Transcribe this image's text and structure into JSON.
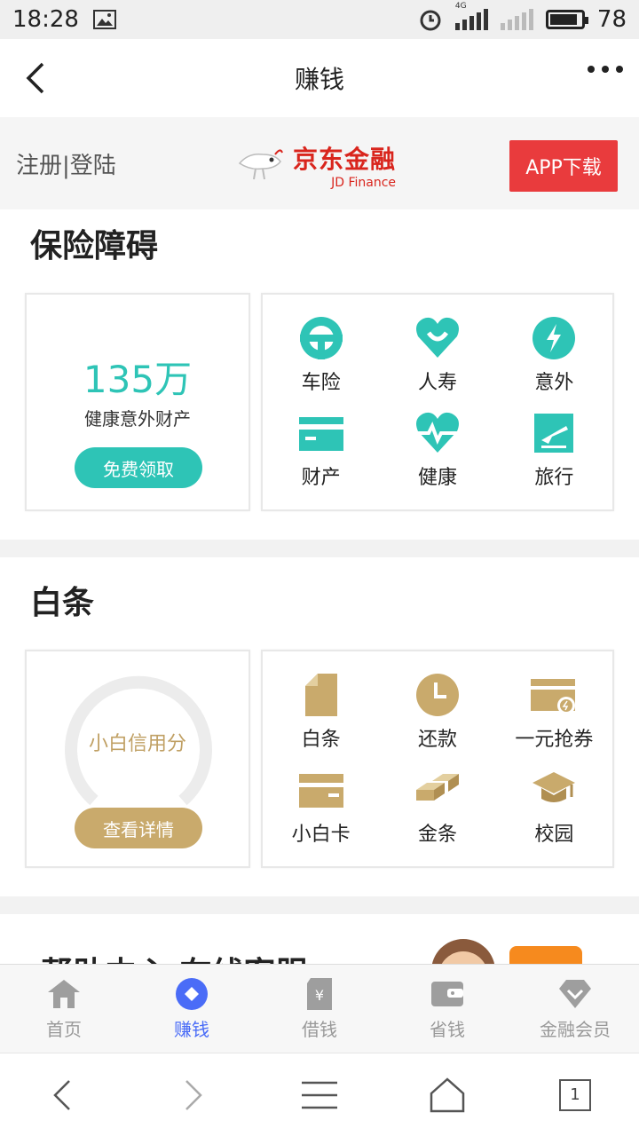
{
  "status_bar": {
    "time": "18:28",
    "network": "4G",
    "battery_level": "78"
  },
  "header": {
    "title": "赚钱"
  },
  "banner": {
    "login_label": "注册|登陆",
    "brand_cn": "京东金融",
    "brand_en": "JD Finance",
    "download_label": "APP下载"
  },
  "insurance": {
    "title": "保险障碍",
    "amount": "135万",
    "amount_desc": "健康意外财产",
    "claim_label": "免费领取",
    "items": [
      {
        "label": "车险",
        "icon": "car-insurance-icon"
      },
      {
        "label": "人寿",
        "icon": "life-heart-icon"
      },
      {
        "label": "意外",
        "icon": "lightning-icon"
      },
      {
        "label": "财产",
        "icon": "card-icon"
      },
      {
        "label": "健康",
        "icon": "health-heart-icon"
      },
      {
        "label": "旅行",
        "icon": "plane-icon"
      }
    ],
    "accent_color": "#2ec4b6"
  },
  "baitiao": {
    "title": "白条",
    "score_label": "小白信用分",
    "detail_label": "查看详情",
    "items": [
      {
        "label": "白条",
        "icon": "document-icon"
      },
      {
        "label": "还款",
        "icon": "clock-icon"
      },
      {
        "label": "一元抢券",
        "icon": "coupon-icon"
      },
      {
        "label": "小白卡",
        "icon": "card-icon"
      },
      {
        "label": "金条",
        "icon": "gold-bar-icon"
      },
      {
        "label": "校园",
        "icon": "graduation-cap-icon"
      }
    ],
    "accent_color": "#c9aa6c"
  },
  "help": {
    "title": "帮助中心 在线客服"
  },
  "tabs": [
    {
      "label": "首页",
      "icon": "home-icon",
      "active": false
    },
    {
      "label": "赚钱",
      "icon": "earn-icon",
      "active": true
    },
    {
      "label": "借钱",
      "icon": "borrow-icon",
      "active": false
    },
    {
      "label": "省钱",
      "icon": "wallet-icon",
      "active": false
    },
    {
      "label": "金融会员",
      "icon": "diamond-icon",
      "active": false
    }
  ],
  "browser_nav": {
    "tab_count": "1"
  }
}
